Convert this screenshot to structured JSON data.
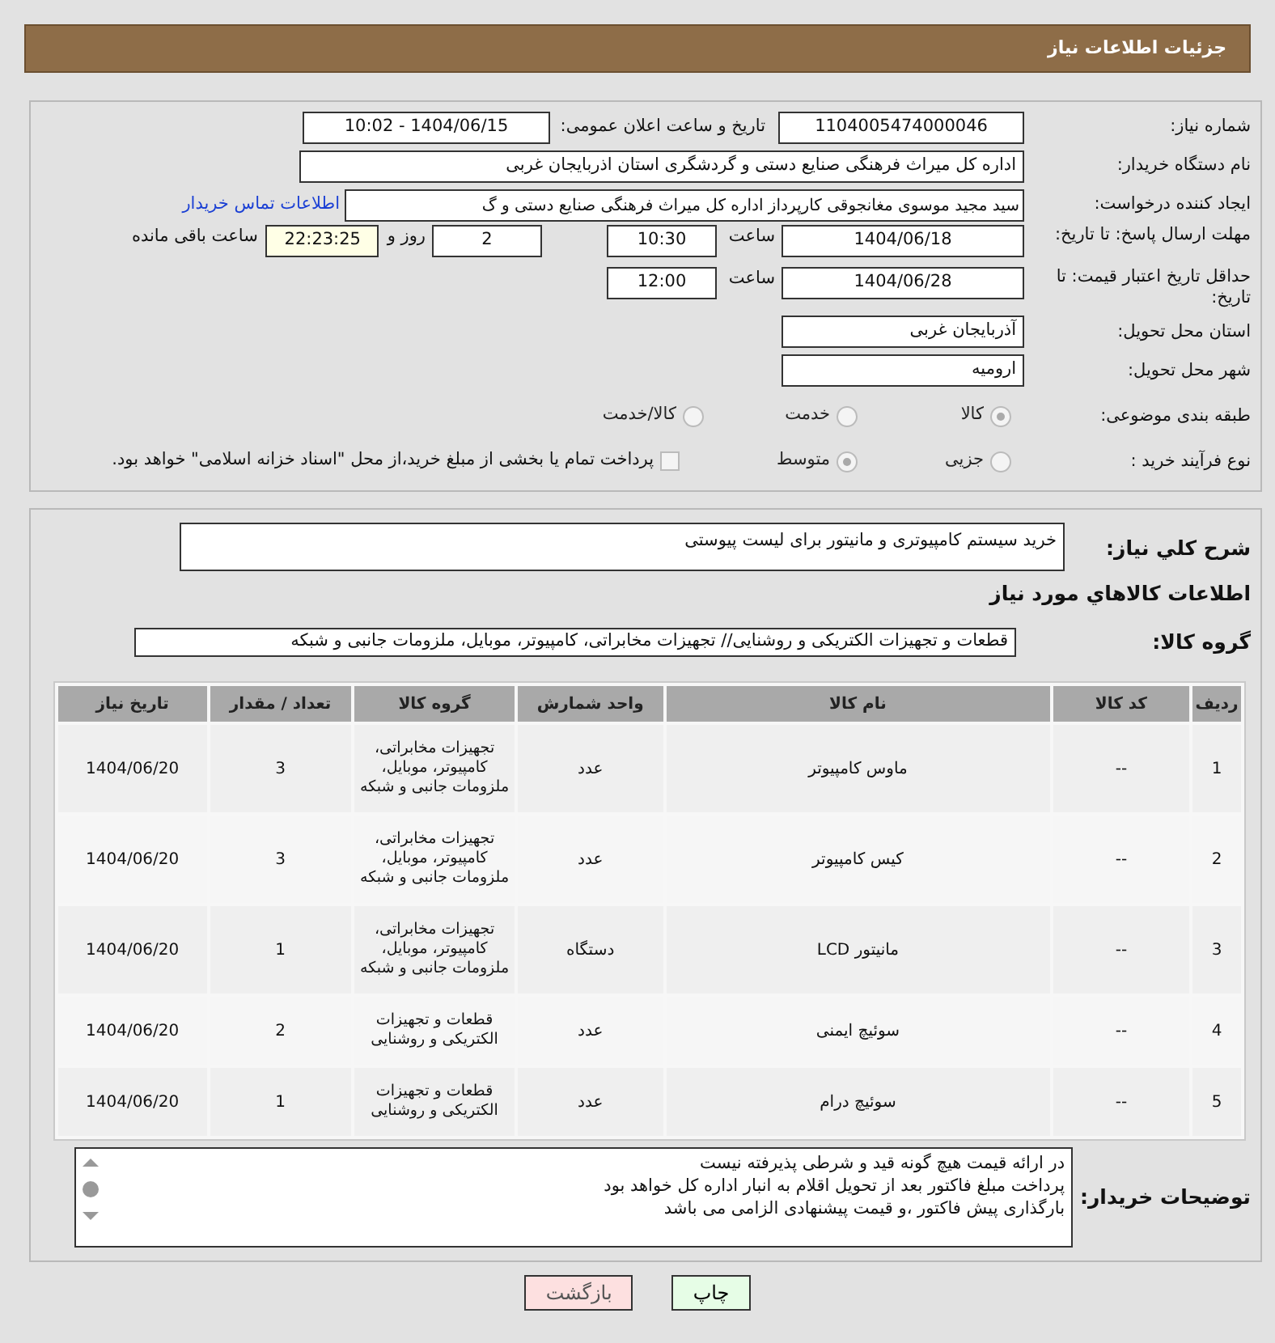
{
  "header": {
    "title": "جزئیات اطلاعات نیاز"
  },
  "need_number": {
    "label": "شماره نیاز:",
    "value": "1104005474000046"
  },
  "announce": {
    "label": "تاریخ و ساعت اعلان عمومی:",
    "value": "1404/06/15 - 10:02"
  },
  "buyer": {
    "label": "نام دستگاه خریدار:",
    "value": "اداره کل میراث فرهنگی  صنایع دستی و گردشگری استان اذربایجان غربی"
  },
  "requester": {
    "label": "ایجاد کننده درخواست:",
    "value": "سید مجید موسوی مغانجوقی کارپرداز اداره کل میراث فرهنگی  صنایع دستی و گ",
    "link": "اطلاعات تماس خریدار"
  },
  "deadline": {
    "label": "مهلت ارسال پاسخ: تا تاریخ:",
    "date": "1404/06/18",
    "time_label": "ساعت",
    "time": "10:30",
    "days": "2",
    "days_label": "روز و",
    "remaining": "22:23:25",
    "remaining_label": "ساعت باقی مانده"
  },
  "validity": {
    "label": "حداقل تاریخ اعتبار قیمت: تا تاریخ:",
    "date": "1404/06/28",
    "time_label": "ساعت",
    "time": "12:00"
  },
  "province": {
    "label": "استان محل تحویل:",
    "value": "آذربایجان غربی"
  },
  "city": {
    "label": "شهر محل تحویل:",
    "value": "ارومیه"
  },
  "category": {
    "label": "طبقه بندی موضوعی:",
    "options": [
      {
        "label": "کالا",
        "selected": true
      },
      {
        "label": "خدمت",
        "selected": false
      },
      {
        "label": "کالا/خدمت",
        "selected": false
      }
    ]
  },
  "process": {
    "label": "نوع فرآیند خرید :",
    "options": [
      {
        "label": "جزیی",
        "selected": false
      },
      {
        "label": "متوسط",
        "selected": true
      }
    ],
    "treasury": {
      "checked": false,
      "label": "پرداخت تمام یا بخشی از مبلغ خرید،از محل \"اسناد خزانه اسلامی\" خواهد بود."
    }
  },
  "description": {
    "label": "شرح کلي نياز:",
    "value": "خرید سیستم کامپیوتری و مانیتور برای لیست پیوستی"
  },
  "goods_heading": "اطلاعات كالاهاي مورد نياز",
  "goods_group": {
    "label": "گروه کالا:",
    "value": "قطعات و تجهیزات الکتریکی و روشنایی// تجهیزات مخابراتی، کامپیوتر، موبایل، ملزومات جانبی و شبکه"
  },
  "table": {
    "columns": [
      "ردیف",
      "کد کالا",
      "نام کالا",
      "واحد شمارش",
      "گروه کالا",
      "تعداد / مقدار",
      "تاریخ نیاز"
    ],
    "rows": [
      [
        "1",
        "--",
        "ماوس کامپیوتر",
        "عدد",
        "تجهیزات مخابراتی، کامپیوتر، موبایل، ملزومات جانبی و شبکه",
        "3",
        "1404/06/20"
      ],
      [
        "2",
        "--",
        "کیس کامپیوتر",
        "عدد",
        "تجهیزات مخابراتی، کامپیوتر، موبایل، ملزومات جانبی و شبکه",
        "3",
        "1404/06/20"
      ],
      [
        "3",
        "--",
        "مانیتور LCD",
        "دستگاه",
        "تجهیزات مخابراتی، کامپیوتر، موبایل، ملزومات جانبی و شبکه",
        "1",
        "1404/06/20"
      ],
      [
        "4",
        "--",
        "سوئیچ ایمنی",
        "عدد",
        "قطعات و تجهیزات الکتریکی و روشنایی",
        "2",
        "1404/06/20"
      ],
      [
        "5",
        "--",
        "سوئیچ درام",
        "عدد",
        "قطعات و تجهیزات الکتریکی و روشنایی",
        "1",
        "1404/06/20"
      ]
    ]
  },
  "buyer_notes": {
    "label": "توضیحات خریدار:",
    "lines": [
      "در ارائه قیمت هیچ گونه قید و شرطی پذیرفته نیست",
      "پرداخت مبلغ فاکتور بعد از تحویل اقلام به انبار اداره کل خواهد بود",
      "بارگذاری پیش فاکتور ،و قیمت پیشنهادی الزامی می باشد"
    ]
  },
  "buttons": [
    {
      "label": "چاپ",
      "kind": "print"
    },
    {
      "label": "بازگشت",
      "kind": "back"
    }
  ]
}
